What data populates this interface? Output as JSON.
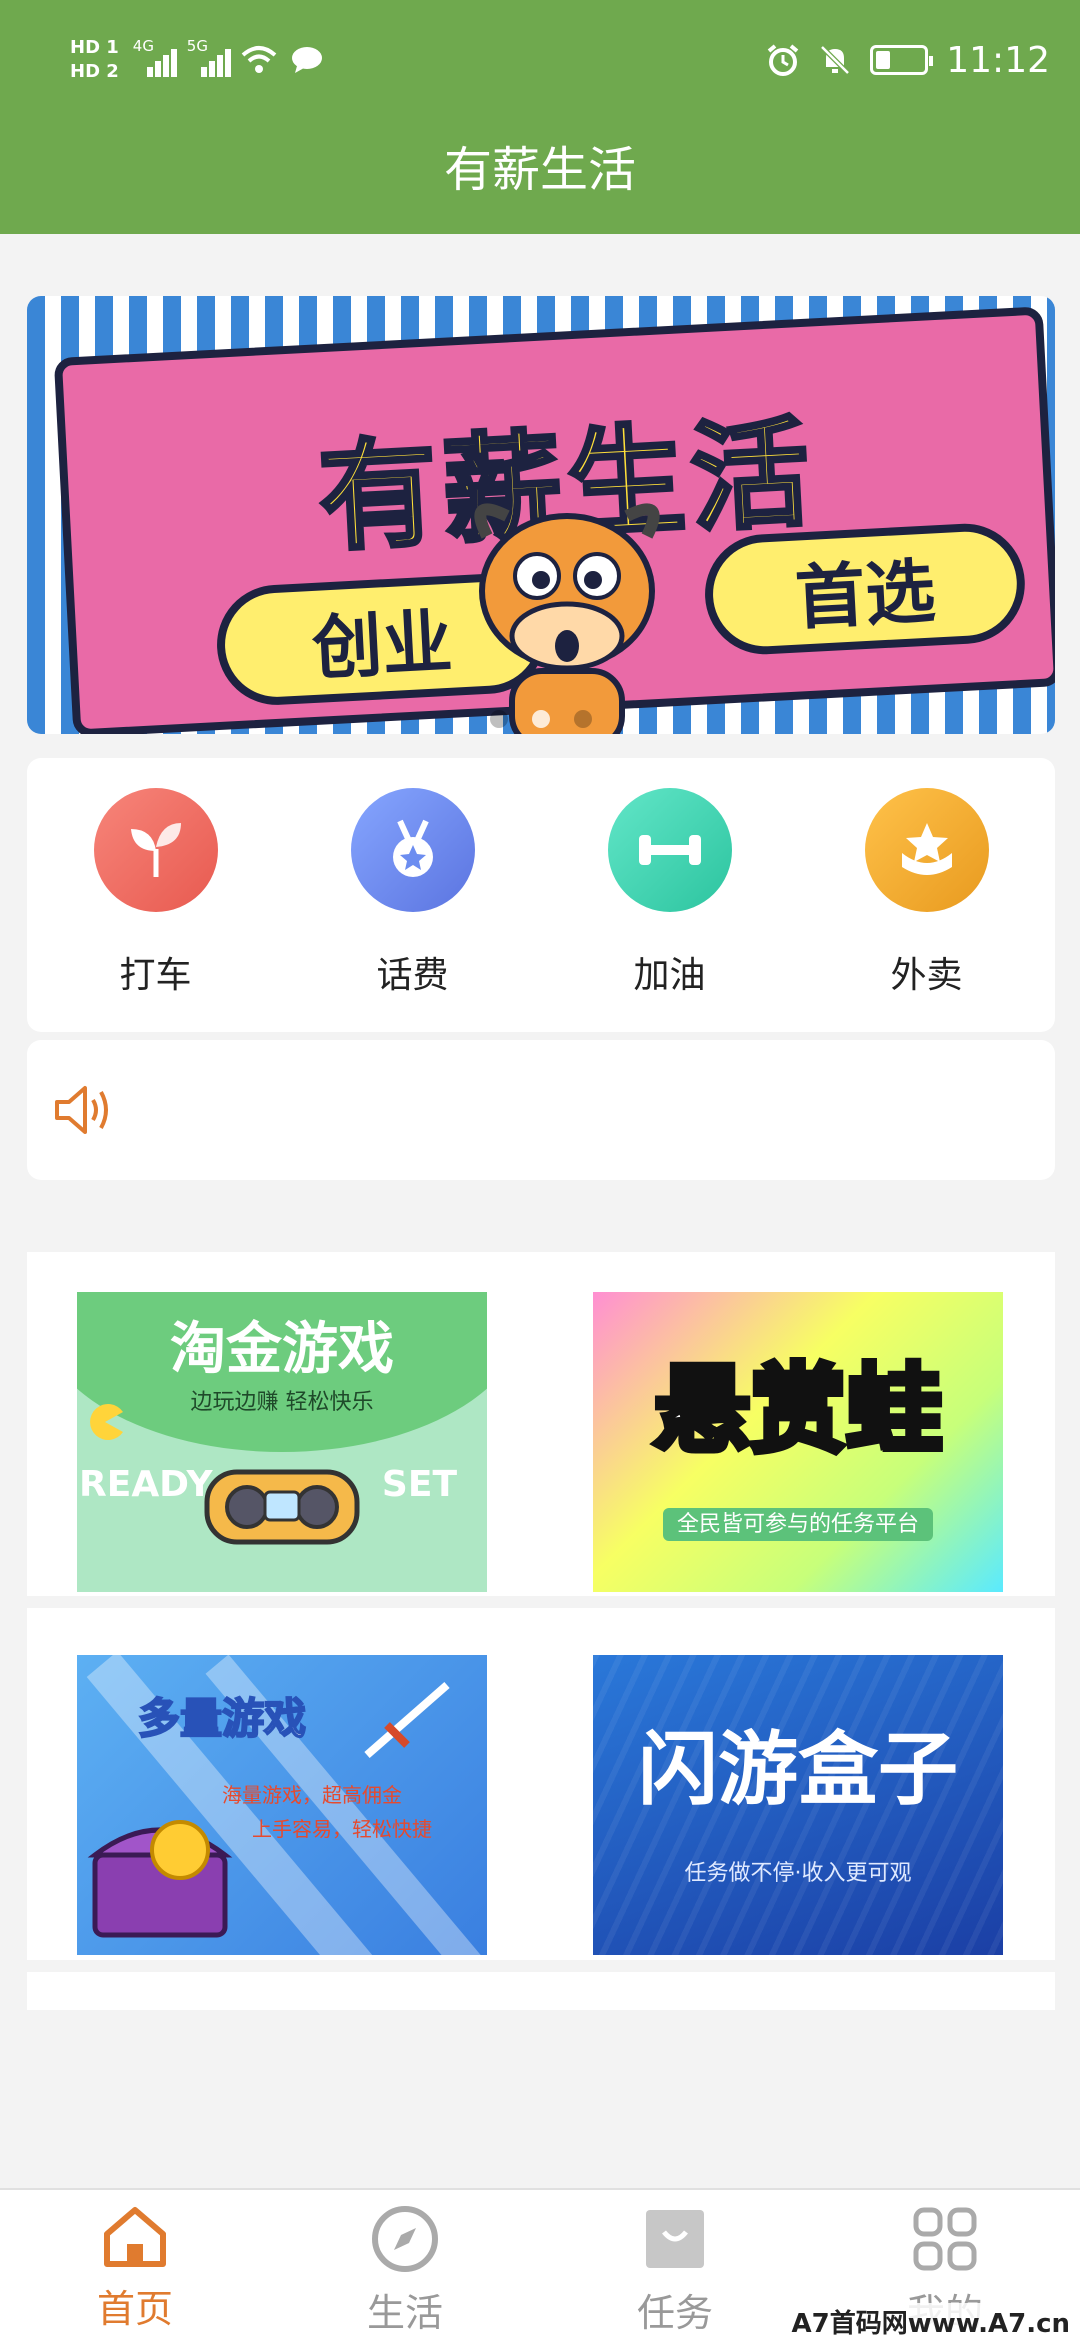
{
  "status_bar": {
    "hd1": "HD 1",
    "hd2": "HD 2",
    "net1": "4G",
    "net2": "5G",
    "time": "11:12"
  },
  "header": {
    "title": "有薪生活"
  },
  "banner": {
    "title": "有薪生活",
    "left_pill": "创业",
    "right_pill": "首选",
    "slide_count": 3,
    "active_slide": 1
  },
  "quick_actions": [
    {
      "label": "打车",
      "icon": "sprout-icon",
      "color": "#ef6e62"
    },
    {
      "label": "话费",
      "icon": "medal-icon",
      "color": "#6c8df0"
    },
    {
      "label": "加油",
      "icon": "dumbbell-icon",
      "color": "#3fd2b2"
    },
    {
      "label": "外卖",
      "icon": "star-badge-icon",
      "color": "#f0a52e"
    }
  ],
  "notice": {
    "icon": "speaker-icon"
  },
  "games": [
    {
      "title": "淘金游戏",
      "sub": "边玩边赚 轻松快乐",
      "extra_left": "READY",
      "extra_right": "SET"
    },
    {
      "title": "悬赏蛙",
      "sub": "全民皆可参与的任务平台"
    },
    {
      "title": "多量游戏",
      "sub": "海量游戏，超高佣金",
      "sub2": "上手容易，轻松快捷"
    },
    {
      "title": "闪游盒子",
      "sub": "任务做不停·收入更可观"
    }
  ],
  "tabs": [
    {
      "label": "首页",
      "icon": "home-icon",
      "active": true
    },
    {
      "label": "生活",
      "icon": "compass-icon",
      "active": false
    },
    {
      "label": "任务",
      "icon": "bag-icon",
      "active": false
    },
    {
      "label": "我的",
      "icon": "grid-icon",
      "active": false
    }
  ],
  "watermark": "A7首码网www.A7.cn",
  "colors": {
    "brand_green": "#6fa94e",
    "accent_orange": "#e07b2f"
  }
}
